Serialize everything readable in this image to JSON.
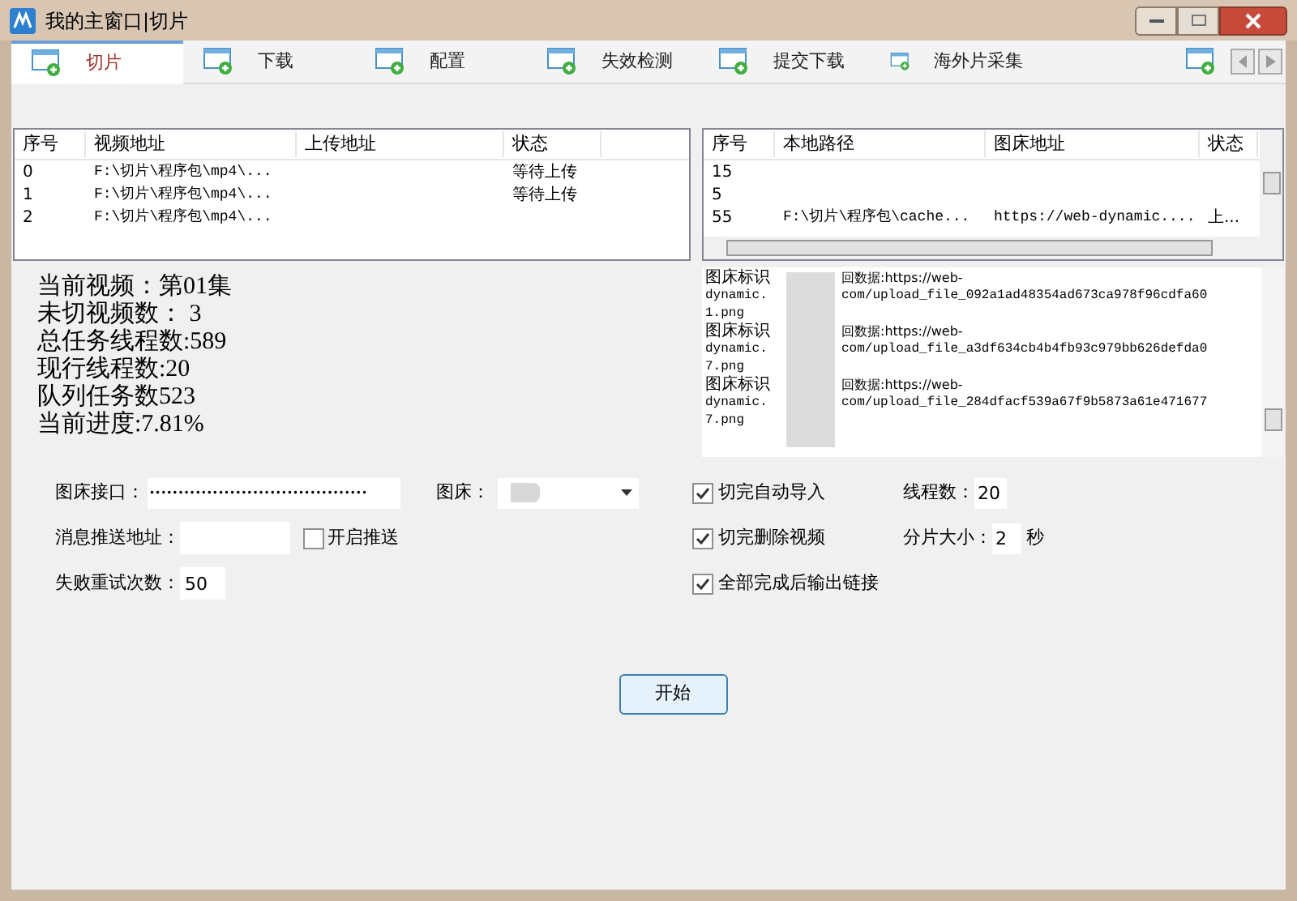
{
  "window": {
    "title": "我的主窗口|切片"
  },
  "tabs": [
    {
      "label": "切片",
      "selected": true
    },
    {
      "label": "下载",
      "selected": false
    },
    {
      "label": "配置",
      "selected": false
    },
    {
      "label": "失效检测",
      "selected": false
    },
    {
      "label": "提交下载",
      "selected": false
    },
    {
      "label": "海外片采集",
      "selected": false
    }
  ],
  "video_table": {
    "columns": [
      "序号",
      "视频地址",
      "上传地址",
      "状态"
    ],
    "rows": [
      [
        "0",
        "F:\\切片\\程序包\\mp4\\...",
        "",
        "等待上传"
      ],
      [
        "1",
        "F:\\切片\\程序包\\mp4\\...",
        "",
        "等待上传"
      ],
      [
        "2",
        "F:\\切片\\程序包\\mp4\\...",
        "",
        ""
      ]
    ]
  },
  "image_table": {
    "columns": [
      "序号",
      "本地路径",
      "图床地址",
      "状态"
    ],
    "rows": [
      [
        "15",
        "",
        "",
        ""
      ],
      [
        "5",
        "",
        "",
        ""
      ],
      [
        "55",
        "F:\\切片\\程序包\\cache...",
        "https://web-dynamic....",
        "上..."
      ]
    ]
  },
  "stats": [
    "当前视频：第01集",
    "未切视频数： 3",
    "总任务线程数:589",
    "现行线程数:20",
    "队列任务数523",
    "当前进度:7.81%"
  ],
  "log": [
    {
      "head": "图床标识",
      "tail": "回数据:https://web-",
      "line2_head": "dynamic.",
      "line2_tail": "com/upload_file_092a1ad48354ad673ca978f96cdfa60",
      "line3": "1.png"
    },
    {
      "head": "图床标识",
      "tail": "回数据:https://web-",
      "line2_head": "dynamic.",
      "line2_tail": "com/upload_file_a3df634cb4b4fb93c979bb626defda0",
      "line3": "7.png"
    },
    {
      "head": "图床标识",
      "tail": "回数据:https://web-",
      "line2_head": "dynamic.",
      "line2_tail": "com/upload_file_284dfacf539a67f9b5873a61e471677",
      "line3": "7.png"
    }
  ],
  "form": {
    "image_api_label": "图床接口：",
    "image_api_value": "••••••••••••••••••••••••••••••••••••••",
    "image_host_label": "图床：",
    "push_url_label": "消息推送地址：",
    "push_toggle": {
      "label": "开启推送",
      "checked": false
    },
    "retry_label": "失败重试次数：",
    "retry_value": "50",
    "options": [
      {
        "label": "切完自动导入",
        "checked": true
      },
      {
        "label": "切完删除视频",
        "checked": true
      },
      {
        "label": "全部完成后输出链接",
        "checked": true
      }
    ],
    "threads_label": "线程数：",
    "threads_value": "20",
    "slice_label": "分片大小：",
    "slice_value": "2",
    "slice_unit": "秒"
  },
  "start_button": "开始"
}
